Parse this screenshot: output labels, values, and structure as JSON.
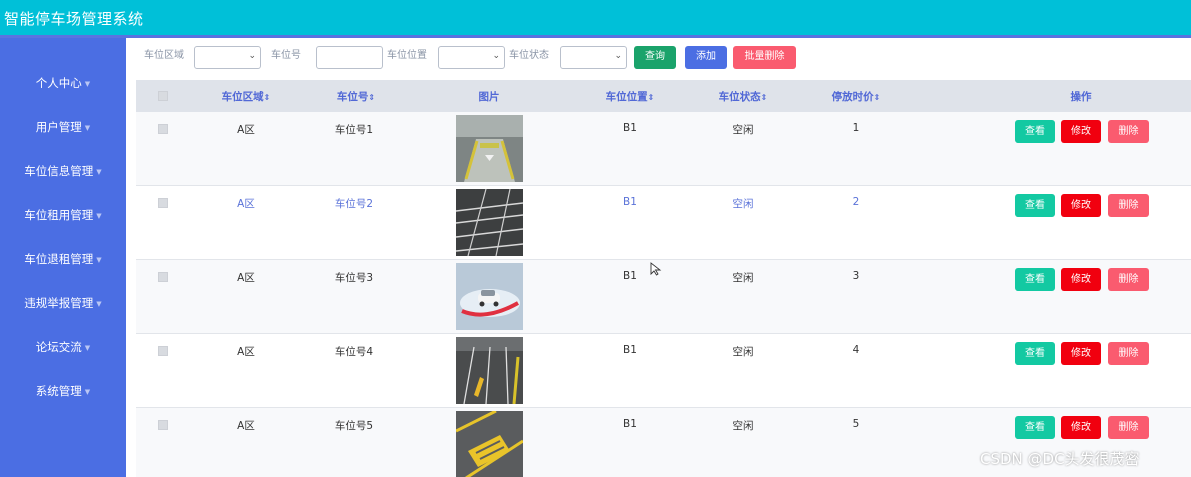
{
  "app": {
    "title": "智能停车场管理系统"
  },
  "sidebar": {
    "items": [
      {
        "label": "个人中心"
      },
      {
        "label": "用户管理"
      },
      {
        "label": "车位信息管理"
      },
      {
        "label": "车位租用管理"
      },
      {
        "label": "车位退租管理"
      },
      {
        "label": "违规举报管理"
      },
      {
        "label": "论坛交流"
      },
      {
        "label": "系统管理"
      }
    ]
  },
  "search": {
    "area_label": "车位区域",
    "number_label": "车位号",
    "position_label": "车位位置",
    "status_label": "车位状态",
    "query_button": "查询",
    "add_button": "添加",
    "batch_delete_button": "批量删除"
  },
  "table": {
    "headers": {
      "area": "车位区域",
      "number": "车位号",
      "image": "图片",
      "position": "车位位置",
      "status": "车位状态",
      "duration": "停放时价",
      "actions": "操作"
    },
    "rows": [
      {
        "area": "A区",
        "number": "车位号1",
        "position": "B1",
        "status": "空闲",
        "duration": "1"
      },
      {
        "area": "A区",
        "number": "车位号2",
        "position": "B1",
        "status": "空闲",
        "duration": "2"
      },
      {
        "area": "A区",
        "number": "车位号3",
        "position": "B1",
        "status": "空闲",
        "duration": "3"
      },
      {
        "area": "A区",
        "number": "车位号4",
        "position": "B1",
        "status": "空闲",
        "duration": "4"
      },
      {
        "area": "A区",
        "number": "车位号5",
        "position": "B1",
        "status": "空闲",
        "duration": "5"
      }
    ],
    "actions": {
      "view": "查看",
      "edit": "修改",
      "delete": "删除"
    }
  },
  "watermark": "CSDN @DC头发很茂密",
  "colors": {
    "header": "#00c0d8",
    "sidebar": "#4b6ee3",
    "query": "#1aa36b",
    "add": "#4b6ee3",
    "batch_delete": "#fa5b6f",
    "view": "#13c9a2",
    "edit": "#f1000f",
    "delete": "#fa5b6f"
  }
}
